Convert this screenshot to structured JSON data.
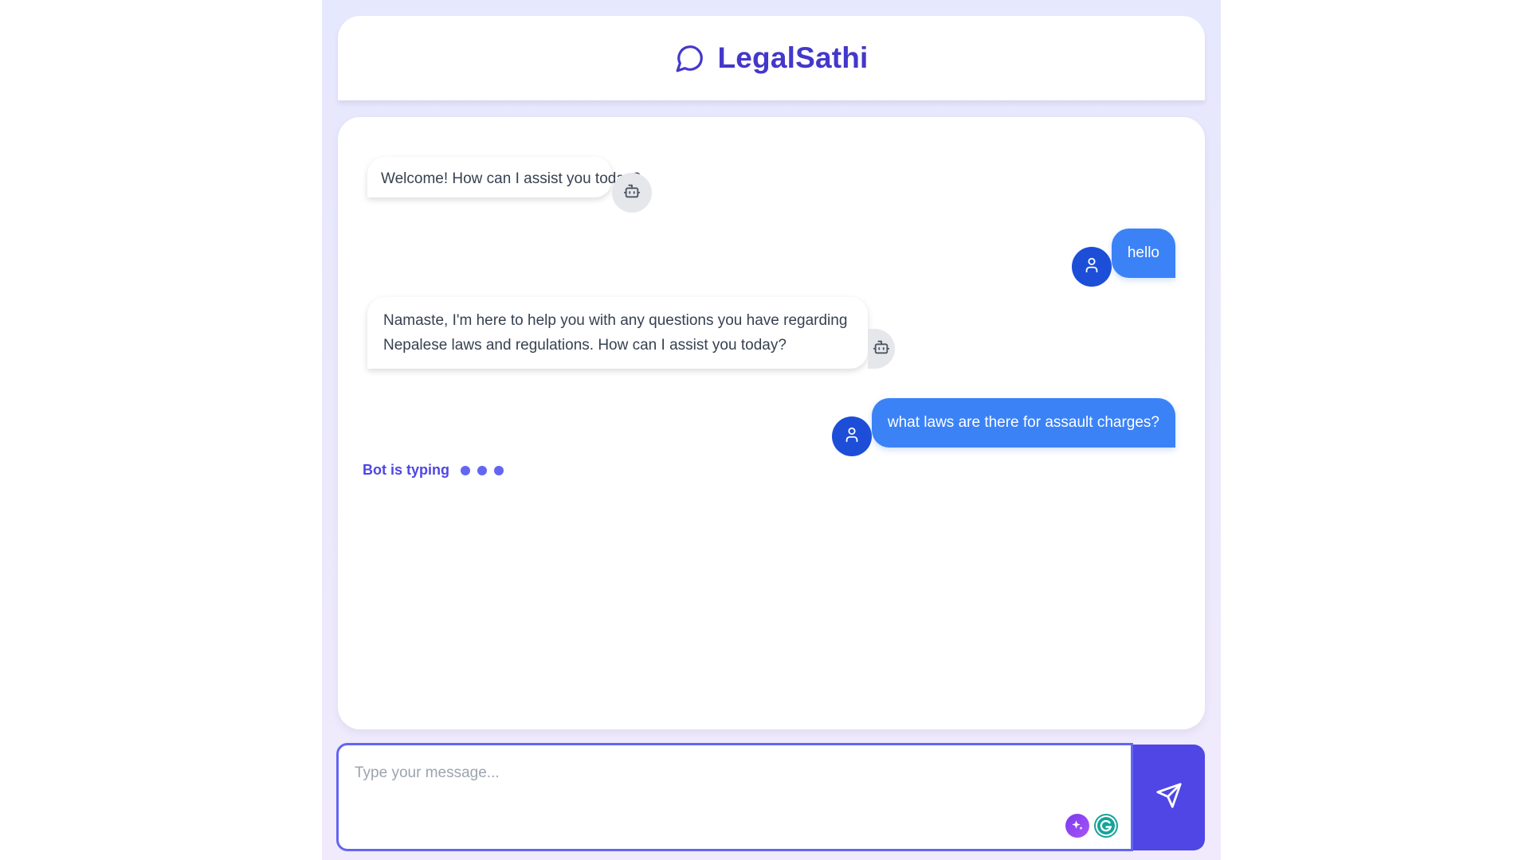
{
  "header": {
    "title": "LegalSathi",
    "logo_icon": "message-circle-icon"
  },
  "messages": [
    {
      "sender": "bot",
      "text": "Welcome! How can I assist you today?",
      "avatar_icon": "bot-icon"
    },
    {
      "sender": "user",
      "text": "hello",
      "avatar_icon": "user-icon"
    },
    {
      "sender": "bot",
      "text": "Namaste, I'm here to help you with any questions you have regarding Nepalese laws and regulations. How can I assist you today?",
      "avatar_icon": "bot-icon"
    },
    {
      "sender": "user",
      "text": "what laws are there for assault charges?",
      "avatar_icon": "user-icon"
    }
  ],
  "typing": {
    "label": "Bot is typing"
  },
  "composer": {
    "placeholder": "Type your message...",
    "value": "",
    "send_icon": "send-icon",
    "extension_icons": [
      "sparkle-extension-icon",
      "grammarly-icon"
    ]
  },
  "colors": {
    "accent": "#4f46e5",
    "title": "#4338ca",
    "user_bubble": "#3b82f6",
    "user_avatar": "#1d4ed8",
    "bot_avatar": "#e5e7eb",
    "background_gradient_start": "#e6e8fd",
    "background_gradient_end": "#f0eafc"
  }
}
